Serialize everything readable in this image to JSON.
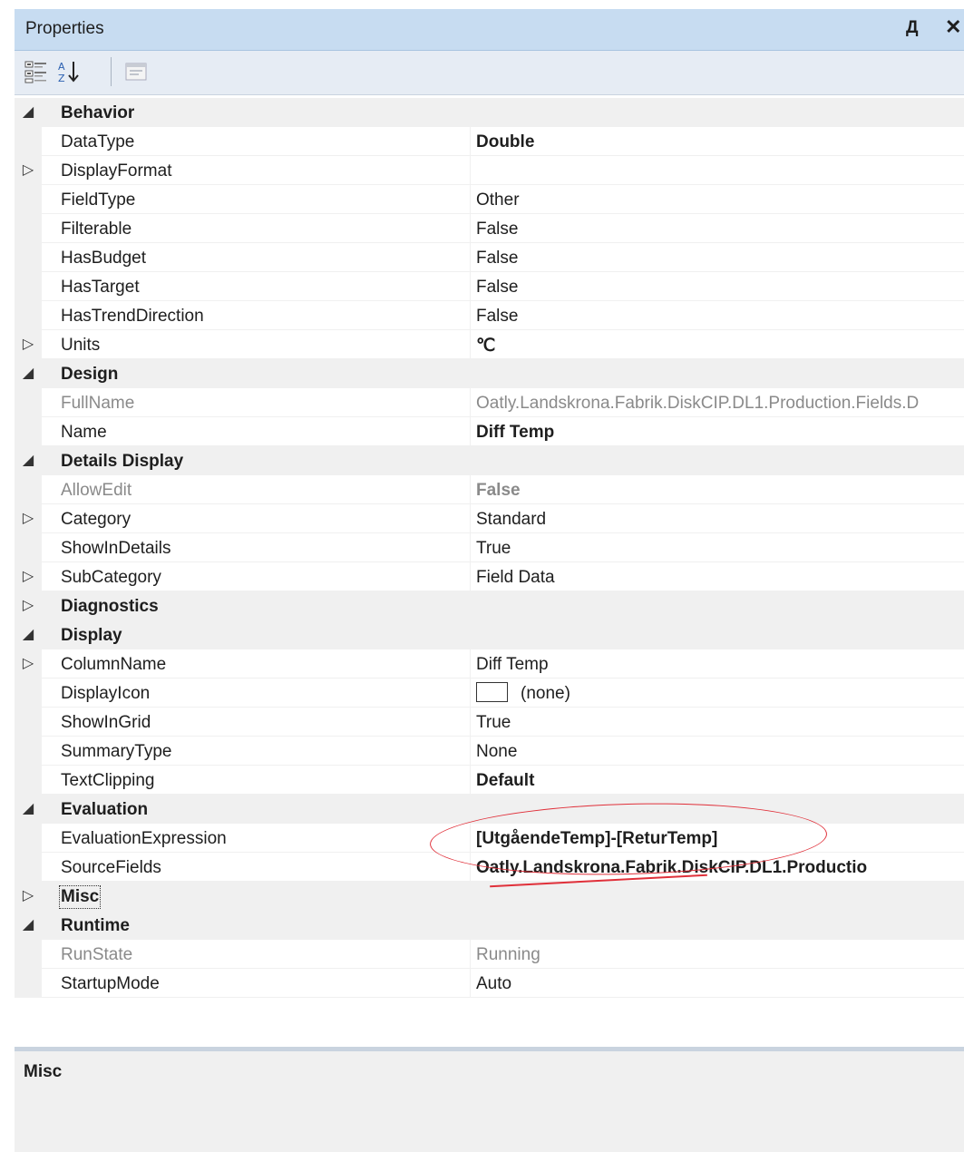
{
  "panel": {
    "title": "Properties",
    "pin_glyph": "Д",
    "close_glyph": "✕"
  },
  "toolbar": {
    "buttons": [
      {
        "name": "categorized-icon"
      },
      {
        "name": "alphabetical-icon"
      },
      {
        "name": "property-pages-icon"
      }
    ]
  },
  "rows": [
    {
      "type": "category",
      "name": "Behavior",
      "expanded": true
    },
    {
      "type": "prop",
      "name": "DataType",
      "value": "Double",
      "bold": true
    },
    {
      "type": "prop",
      "name": "DisplayFormat",
      "value": "",
      "expandable": true
    },
    {
      "type": "prop",
      "name": "FieldType",
      "value": "Other"
    },
    {
      "type": "prop",
      "name": "Filterable",
      "value": "False"
    },
    {
      "type": "prop",
      "name": "HasBudget",
      "value": "False"
    },
    {
      "type": "prop",
      "name": "HasTarget",
      "value": "False"
    },
    {
      "type": "prop",
      "name": "HasTrendDirection",
      "value": "False"
    },
    {
      "type": "prop",
      "name": "Units",
      "value": "℃",
      "bold": true,
      "expandable": true
    },
    {
      "type": "category",
      "name": "Design",
      "expanded": true
    },
    {
      "type": "prop",
      "name": "FullName",
      "value": "Oatly.Landskrona.Fabrik.DiskCIP.DL1.Production.Fields.D",
      "readonly": true
    },
    {
      "type": "prop",
      "name": "Name",
      "value": "Diff Temp",
      "bold": true
    },
    {
      "type": "category",
      "name": "Details Display",
      "expanded": true
    },
    {
      "type": "prop",
      "name": "AllowEdit",
      "value": "False",
      "readonly": true,
      "bold": true
    },
    {
      "type": "prop",
      "name": "Category",
      "value": "Standard",
      "expandable": true
    },
    {
      "type": "prop",
      "name": "ShowInDetails",
      "value": "True"
    },
    {
      "type": "prop",
      "name": "SubCategory",
      "value": "Field Data",
      "expandable": true
    },
    {
      "type": "category",
      "name": "Diagnostics",
      "expanded": false
    },
    {
      "type": "category",
      "name": "Display",
      "expanded": true
    },
    {
      "type": "prop",
      "name": "ColumnName",
      "value": "Diff Temp",
      "expandable": true
    },
    {
      "type": "prop",
      "name": "DisplayIcon",
      "value": "(none)",
      "icon_box": true
    },
    {
      "type": "prop",
      "name": "ShowInGrid",
      "value": "True"
    },
    {
      "type": "prop",
      "name": "SummaryType",
      "value": "None"
    },
    {
      "type": "prop",
      "name": "TextClipping",
      "value": "Default",
      "bold": true
    },
    {
      "type": "category",
      "name": "Evaluation",
      "expanded": true
    },
    {
      "type": "prop",
      "name": "EvaluationExpression",
      "value": "[UtgåendeTemp]-[ReturTemp]",
      "bold": true
    },
    {
      "type": "prop",
      "name": "SourceFields",
      "value": "Oatly.Landskrona.Fabrik.DiskCIP.DL1.Productio",
      "bold": true
    },
    {
      "type": "category",
      "name": "Misc",
      "expanded": false,
      "focused": true
    },
    {
      "type": "category",
      "name": "Runtime",
      "expanded": true
    },
    {
      "type": "prop",
      "name": "RunState",
      "value": "Running",
      "readonly": true
    },
    {
      "type": "prop",
      "name": "StartupMode",
      "value": "Auto"
    }
  ],
  "glyphs": {
    "expanded": "◢",
    "collapsed": "▷"
  },
  "description": {
    "heading": "Misc"
  },
  "colors": {
    "titlebar": "#c7dcf1",
    "annotation": "#e0303a",
    "category_bg": "#f0f0f0"
  }
}
